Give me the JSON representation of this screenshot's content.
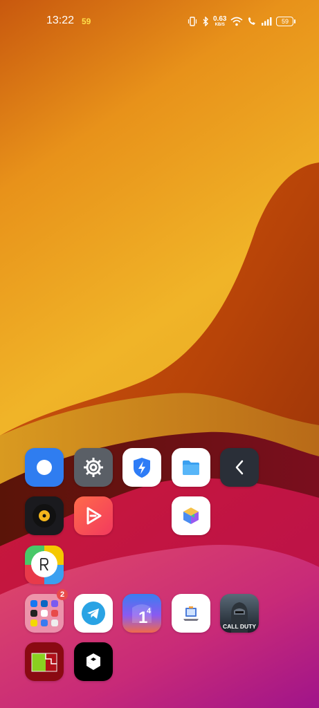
{
  "status_bar": {
    "time": "13:22",
    "fps": "59",
    "net_speed_value": "0.63",
    "net_speed_unit": "KB/S",
    "battery_level": "59"
  },
  "home_screen": {
    "apps": [
      {
        "icon": "blue-circle-app-icon"
      },
      {
        "icon": "settings-gear-icon"
      },
      {
        "icon": "shield-bolt-app-icon"
      },
      {
        "icon": "folder-files-icon"
      },
      {
        "icon": "back-arrow-app-icon"
      },
      {
        "icon": "music-disc-app-icon"
      },
      {
        "icon": "video-play-app-icon"
      },
      {
        "icon": "colorful-cube-app-icon"
      },
      {
        "icon": "realme-community-icon"
      },
      {
        "icon": "app-folder-icon"
      },
      {
        "icon": "telegram-icon"
      },
      {
        "icon": "number-one-app-icon"
      },
      {
        "icon": "laptop-app-icon"
      },
      {
        "icon": "call-of-duty-icon"
      },
      {
        "icon": "chart-widget-app-icon"
      },
      {
        "icon": "9gag-icon"
      }
    ],
    "folder_badge": "2",
    "cod_label": "CALL DUTY"
  }
}
